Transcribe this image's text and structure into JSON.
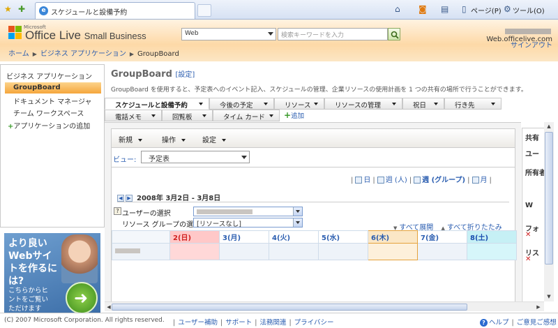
{
  "browser": {
    "tab_title": "スケジュールと設備予約",
    "page_menu": "ページ(P)",
    "tools_menu": "ツール(O)"
  },
  "header": {
    "logo_microsoft": "Microsoft",
    "logo_office_live": "Office Live",
    "logo_small_business": "Small Business",
    "service_select": "Web",
    "search_placeholder": "検索キーワードを入力",
    "user_domain": "Web.officelive.com",
    "signout": "サインアウト"
  },
  "breadcrumb": {
    "home": "ホーム",
    "apps": "ビジネス アプリケーション",
    "current": "GroupBoard"
  },
  "sidebar": {
    "title": "ビジネス アプリケーション",
    "items": [
      {
        "label": "GroupBoard"
      },
      {
        "label": "ドキュメント マネージャ"
      },
      {
        "label": "チーム ワークスペース"
      },
      {
        "label": "アプリケーションの追加"
      }
    ]
  },
  "ad": {
    "headline": "より良いWebサイトを作るには?",
    "body": "こちらからヒントをご覧いただけます"
  },
  "main": {
    "title": "GroupBoard",
    "settings_link": "設定",
    "description": "GroupBoard を使用すると、予定表へのイベント記入、スケジュールの管理、企業リソースの使用計画を 1 つの共有の場所で行うことができます。"
  },
  "tabs": {
    "row1": [
      {
        "label": "スケジュールと設備予約"
      },
      {
        "label": "今後の予定"
      },
      {
        "label": "リソース"
      },
      {
        "label": "リソースの管理"
      },
      {
        "label": "祝日"
      },
      {
        "label": "行き先"
      }
    ],
    "row2": [
      {
        "label": "電話メモ"
      },
      {
        "label": "回覧板"
      },
      {
        "label": "タイム カード"
      }
    ],
    "add": "追加"
  },
  "toolbar": {
    "new": "新規",
    "actions": "操作",
    "settings": "設定"
  },
  "view": {
    "label": "ビュー:",
    "selected": "予定表"
  },
  "view_links": {
    "day": "日",
    "week_person": "週 (人)",
    "week_group": "週 (グループ)",
    "month": "月"
  },
  "week": {
    "range": "2008年 3月2日 - 3月8日"
  },
  "filters": {
    "user_label": "ユーザーの選択",
    "group_label": "リソース グループの選択",
    "group_value": "[リソースなし]"
  },
  "expand": {
    "expand_all": "すべて展開",
    "collapse_all": "すべて折りたたみ"
  },
  "calendar": {
    "days": [
      "2(日)",
      "3(月)",
      "4(火)",
      "5(水)",
      "6(木)",
      "7(金)",
      "8(土)"
    ]
  },
  "right_panel": {
    "items": [
      "共有",
      "ユー",
      "所有者",
      "W",
      "フォ",
      "リス"
    ]
  },
  "footer": {
    "copyright": "(C) 2007 Microsoft Corporation. All rights reserved.",
    "links": [
      "ユーザー補助",
      "サポート",
      "法務関連",
      "プライバシー"
    ],
    "help": "ヘルプ",
    "feedback": "ご意見ご感想"
  }
}
